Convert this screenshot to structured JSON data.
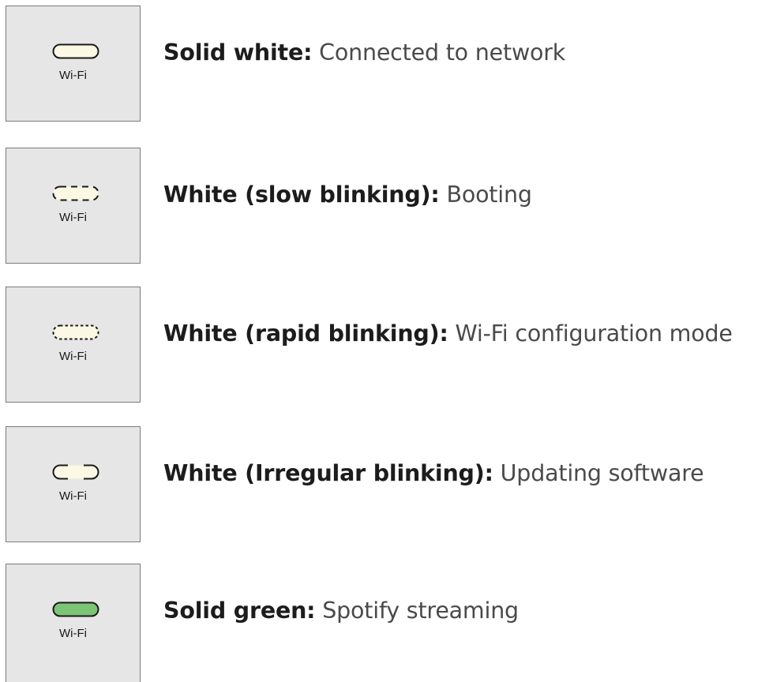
{
  "statuses": [
    {
      "led_label": "Wi-Fi",
      "led_style": "solid",
      "led_color": "#fbf8e3",
      "term": "Solid white:",
      "description": "Connected to network"
    },
    {
      "led_label": "Wi-Fi",
      "led_style": "slow-blink",
      "led_color": "#fbf8e3",
      "term": "White (slow blinking):",
      "description": "Booting"
    },
    {
      "led_label": "Wi-Fi",
      "led_style": "rapid-blink",
      "led_color": "#fbf8e3",
      "term": "White (rapid blinking):",
      "description": "Wi-Fi configuration mode"
    },
    {
      "led_label": "Wi-Fi",
      "led_style": "irregular-blink",
      "led_color": "#fbf8e3",
      "term": "White (Irregular blinking):",
      "description": "Updating software"
    },
    {
      "led_label": "Wi-Fi",
      "led_style": "solid",
      "led_color": "#7cc576",
      "term": "Solid green:",
      "description": "Spotify streaming"
    }
  ],
  "colors": {
    "panel_background": "#e6e6e6",
    "panel_border": "#7b7b7b",
    "led_outline": "#1a1a1a"
  }
}
